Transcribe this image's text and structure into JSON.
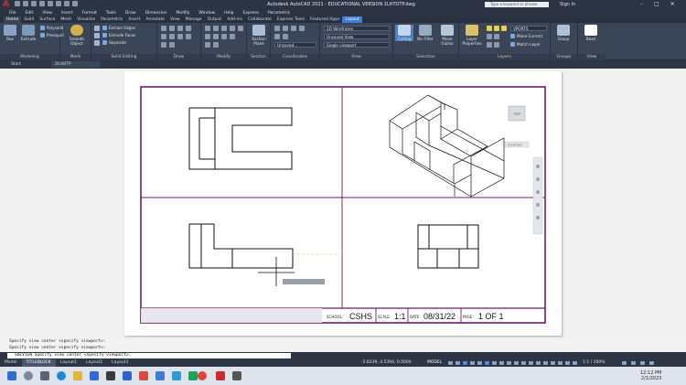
{
  "window": {
    "title": "Autodesk AutoCAD 2021 - EDUCATIONAL VERSION    2LHTOTP.dwg",
    "search_placeholder": "Type a keyword or phrase",
    "sign_in": "Sign In",
    "logo_letter": "A"
  },
  "menu": [
    "File",
    "Edit",
    "View",
    "Insert",
    "Format",
    "Tools",
    "Draw",
    "Dimension",
    "Modify",
    "Window",
    "Help",
    "Express",
    "Parametric"
  ],
  "ribbon_tabs": [
    "Home",
    "Solid",
    "Surface",
    "Mesh",
    "Visualize",
    "Parametric",
    "Insert",
    "Annotate",
    "View",
    "Manage",
    "Output",
    "Add-ins",
    "Collaborate",
    "Express Tools",
    "Featured Apps",
    "Layout"
  ],
  "ribbon": {
    "modeling": {
      "label": "Modeling",
      "box": "Box",
      "extrude": "Extrude",
      "polysolid": "Polysolid",
      "presspull": "Presspull"
    },
    "mesh": {
      "label": "Mesh",
      "smooth": "Smooth Object"
    },
    "solid_editing": {
      "label": "Solid Editing",
      "extract": "Extract Edges",
      "extrude_faces": "Extrude Faces",
      "separate": "Separate"
    },
    "draw": {
      "label": "Draw"
    },
    "modify": {
      "label": "Modify"
    },
    "section": {
      "label": "Section",
      "plane": "Section Plane"
    },
    "coordinates": {
      "label": "Coordinates",
      "unsaved": "Unsaved..."
    },
    "view": {
      "label": "View",
      "visual_style": "2D Wireframe",
      "view_name": "Unsaved View",
      "viewport": "Single viewport"
    },
    "selection": {
      "label": "Selection",
      "culling": "Culling",
      "no_filter": "No Filter",
      "move_gizmo": "Move Gizmo"
    },
    "layers": {
      "label": "Layers",
      "properties": "Layer Properties",
      "vports": "VPORTS",
      "make_current": "Make Current",
      "match_layer": "Match Layer"
    },
    "groups": {
      "label": "Groups",
      "group": "Group"
    },
    "view2": {
      "label": "View",
      "base": "Base"
    }
  },
  "doc_tabs": [
    "Start",
    "2LHOTP"
  ],
  "drawing": {
    "viewcube": "TOP",
    "unnamed": "Unnamed",
    "titleblock": {
      "school_label": "SCHOOL:",
      "school": "CSHS",
      "scale_label": "SCALE:",
      "scale": "1:1",
      "date_label": "DATE:",
      "date": "08/31/22",
      "page_label": "PAGE:",
      "page": "1 OF 1"
    }
  },
  "command": {
    "history": [
      "Specify view center <specify viewport>:",
      "Specify view center <specify viewport>:"
    ],
    "prompt": "SOLVIEW Specify view center <specify viewport>:"
  },
  "layout_tabs": [
    "Model",
    "TITLEBLOCK",
    "Layout1",
    "Layout2",
    "Layout3"
  ],
  "status": {
    "coords": "-5.8239, 4.5394, 0.0000",
    "mode": "MODEL",
    "scale": "1:1 / 100%"
  },
  "taskbar": {
    "time": "12:12 PM",
    "date": "2/1/2023"
  }
}
